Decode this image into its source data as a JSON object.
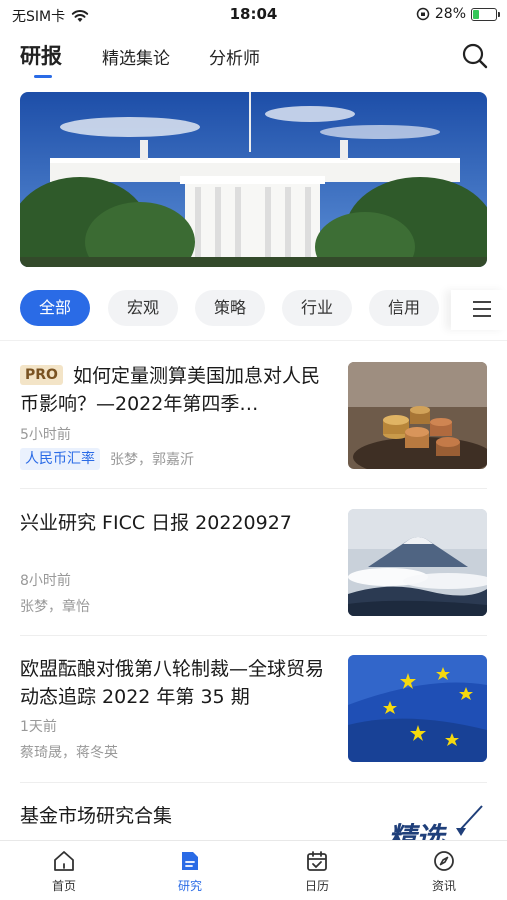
{
  "status_bar": {
    "carrier": "无SIM卡",
    "time": "18:04",
    "battery_percent": "28%",
    "battery_level": 0.28
  },
  "top_tabs": [
    {
      "label": "研报",
      "active": true
    },
    {
      "label": "精选集论",
      "active": false
    },
    {
      "label": "分析师",
      "active": false
    }
  ],
  "categories": [
    {
      "label": "全部",
      "active": true
    },
    {
      "label": "宏观",
      "active": false
    },
    {
      "label": "策略",
      "active": false
    },
    {
      "label": "行业",
      "active": false
    },
    {
      "label": "信用",
      "active": false
    }
  ],
  "articles": [
    {
      "badge": "PRO",
      "title": "如何定量测算美国加息对人民币影响？—2022年第四季…",
      "time": "5小时前",
      "tag": "人民币汇率",
      "authors": "张梦，郭嘉沂",
      "thumbnail": "coins-icon"
    },
    {
      "title": "兴业研究 FICC 日报 20220927",
      "time": "8小时前",
      "authors": "张梦，章怡",
      "thumbnail": "mountain-icon"
    },
    {
      "title": "欧盟酝酿对俄第八轮制裁—全球贸易动态追踪 2022 年第 35 期",
      "time": "1天前",
      "authors": "蔡琦晟，蒋冬英",
      "thumbnail": "eu-flag-icon"
    },
    {
      "title": "基金市场研究合集",
      "thumb_text": "精选"
    }
  ],
  "bottom_nav": [
    {
      "label": "首页",
      "icon": "home-icon",
      "active": false
    },
    {
      "label": "研究",
      "icon": "document-icon",
      "active": true
    },
    {
      "label": "日历",
      "icon": "calendar-icon",
      "active": false
    },
    {
      "label": "资讯",
      "icon": "compass-icon",
      "active": false
    }
  ],
  "colors": {
    "accent": "#2a6be6",
    "pro_badge_bg": "#f3e4c7",
    "tag_bg": "#eaf1fd"
  }
}
